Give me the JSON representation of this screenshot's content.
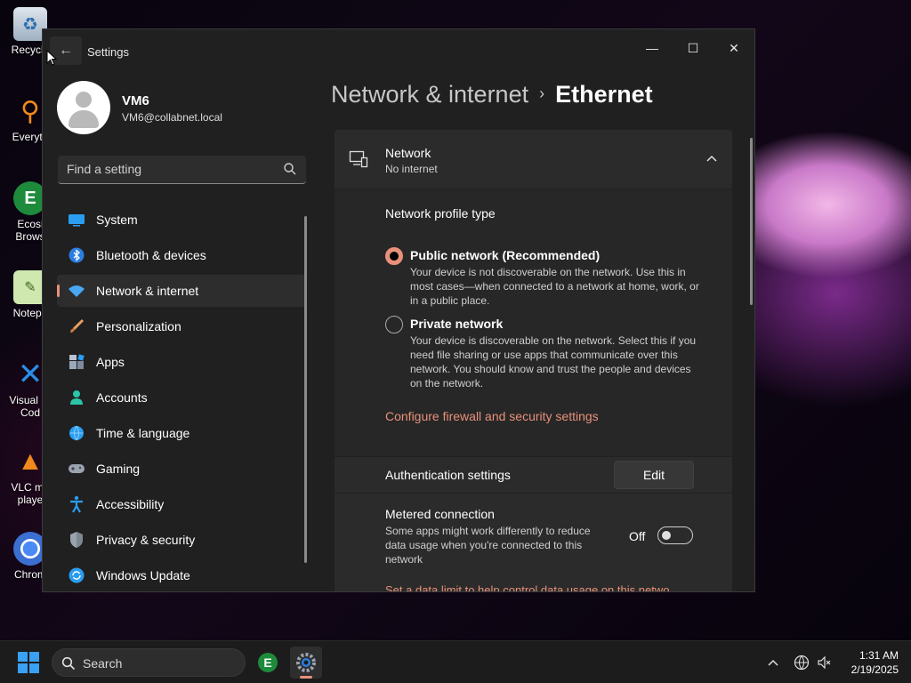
{
  "desktop": {
    "icons": [
      {
        "label": "Recycle",
        "icon": "recycle-bin-icon"
      },
      {
        "label": "Everyth",
        "icon": "everything-search-icon"
      },
      {
        "label": "Ecosi\nBrows",
        "icon": "ecosia-browser-icon"
      },
      {
        "label": "Notepa",
        "icon": "notepad-icon"
      },
      {
        "label": "Visual St\nCod",
        "icon": "vscode-icon"
      },
      {
        "label": "VLC me\nplaye",
        "icon": "vlc-icon"
      },
      {
        "label": "Chrom",
        "icon": "chrome-icon"
      }
    ]
  },
  "window": {
    "title": "Settings",
    "back": "←",
    "minimize": "—",
    "maximize": "☐",
    "close": "✕"
  },
  "profile": {
    "name": "VM6",
    "email": "VM6@collabnet.local"
  },
  "search": {
    "placeholder": "Find a setting"
  },
  "sidebar": {
    "items": [
      {
        "label": "System",
        "icon": "system-icon",
        "active": false
      },
      {
        "label": "Bluetooth & devices",
        "icon": "bluetooth-icon",
        "active": false
      },
      {
        "label": "Network & internet",
        "icon": "wifi-icon",
        "active": true
      },
      {
        "label": "Personalization",
        "icon": "brush-icon",
        "active": false
      },
      {
        "label": "Apps",
        "icon": "apps-icon",
        "active": false
      },
      {
        "label": "Accounts",
        "icon": "accounts-icon",
        "active": false
      },
      {
        "label": "Time & language",
        "icon": "globe-clock-icon",
        "active": false
      },
      {
        "label": "Gaming",
        "icon": "gamepad-icon",
        "active": false
      },
      {
        "label": "Accessibility",
        "icon": "accessibility-icon",
        "active": false
      },
      {
        "label": "Privacy & security",
        "icon": "shield-icon",
        "active": false
      },
      {
        "label": "Windows Update",
        "icon": "update-icon",
        "active": false
      }
    ]
  },
  "breadcrumb": {
    "parent": "Network & internet",
    "separator": "›",
    "current": "Ethernet"
  },
  "network_card": {
    "title": "Network",
    "status": "No internet",
    "profile_type_label": "Network profile type",
    "options": [
      {
        "title": "Public network (Recommended)",
        "description": "Your device is not discoverable on the network. Use this in most cases—when connected to a network at home, work, or in a public place.",
        "selected": true
      },
      {
        "title": "Private network",
        "description": "Your device is discoverable on the network. Select this if you need file sharing or use apps that communicate over this network. You should know and trust the people and devices on the network.",
        "selected": false
      }
    ],
    "firewall_link": "Configure firewall and security settings"
  },
  "auth": {
    "label": "Authentication settings",
    "button": "Edit"
  },
  "metered": {
    "label": "Metered connection",
    "description": "Some apps might work differently to reduce data usage when you're connected to this network",
    "state": "Off",
    "on": false,
    "data_limit_link": "Set a data limit to help control data usage on this netwo"
  },
  "taskbar": {
    "search_label": "Search",
    "time": "1:31 AM",
    "date": "2/19/2025"
  },
  "colors": {
    "accent": "#e8907a",
    "window_bg": "#202020",
    "card_bg": "#2b2b2b"
  }
}
